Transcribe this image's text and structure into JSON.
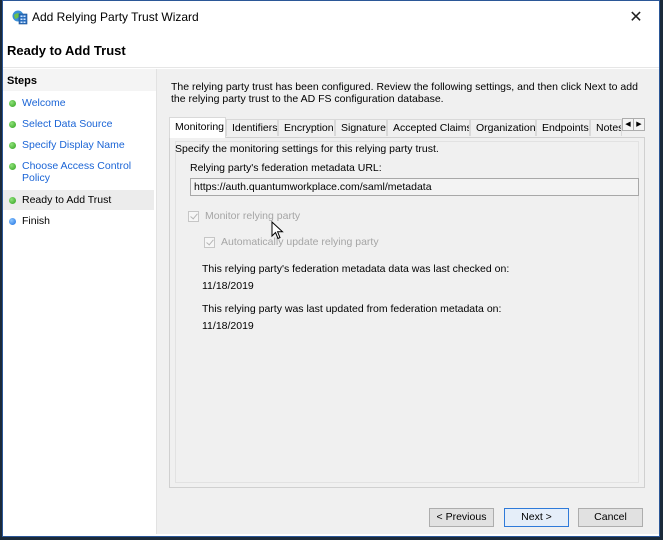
{
  "window": {
    "title": "Add Relying Party Trust Wizard",
    "close_icon": "close-icon"
  },
  "page": {
    "title": "Ready to Add Trust"
  },
  "steps": {
    "heading": "Steps",
    "items": [
      {
        "label": "Welcome",
        "status": "done"
      },
      {
        "label": "Select Data Source",
        "status": "done"
      },
      {
        "label": "Specify Display Name",
        "status": "done"
      },
      {
        "label": "Choose Access Control Policy",
        "status": "done"
      },
      {
        "label": "Ready to Add Trust",
        "status": "current"
      },
      {
        "label": "Finish",
        "status": "pending"
      }
    ]
  },
  "main": {
    "intro": "The relying party trust has been configured. Review the following settings, and then click Next to add the relying party trust to the AD FS configuration database.",
    "tabs": [
      {
        "label": "Monitoring",
        "active": true
      },
      {
        "label": "Identifiers"
      },
      {
        "label": "Encryption"
      },
      {
        "label": "Signature"
      },
      {
        "label": "Accepted Claims"
      },
      {
        "label": "Organization"
      },
      {
        "label": "Endpoints"
      },
      {
        "label": "Notes"
      }
    ],
    "monitoring": {
      "description": "Specify the monitoring settings for this relying party trust.",
      "url_label": "Relying party's federation metadata URL:",
      "url_value": "https://auth.quantumworkplace.com/saml/metadata",
      "monitor_label": "Monitor relying party",
      "monitor_checked": true,
      "auto_update_label": "Automatically update relying party",
      "auto_update_checked": true,
      "last_checked_label": "This relying party's federation metadata data was last checked on:",
      "last_checked_value": "11/18/2019",
      "last_updated_label": "This relying party was last updated from federation metadata on:",
      "last_updated_value": "11/18/2019"
    }
  },
  "buttons": {
    "previous": "< Previous",
    "next": "Next >",
    "cancel": "Cancel"
  },
  "colors": {
    "link": "#1a64d6",
    "step_done": "#2fa01d",
    "step_pending": "#1b6ee0",
    "primary_border": "#2f7ad9"
  }
}
